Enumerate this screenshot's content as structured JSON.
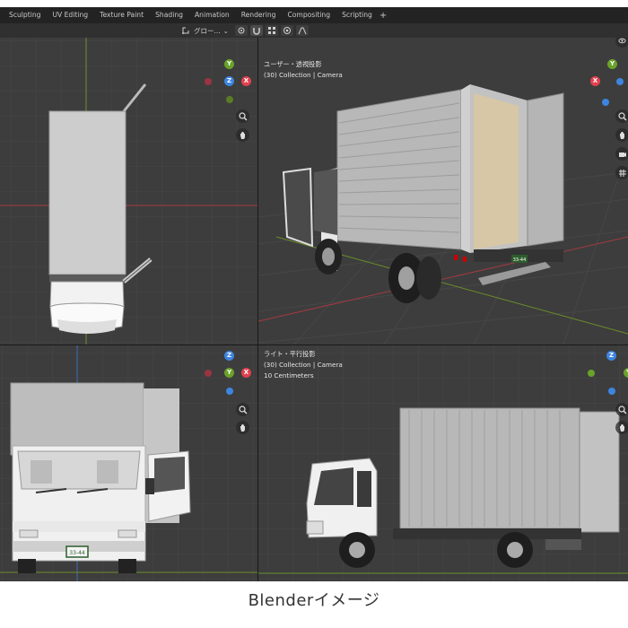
{
  "workspace_tabs": [
    "Sculpting",
    "UV Editing",
    "Texture Paint",
    "Shading",
    "Animation",
    "Rendering",
    "Compositing",
    "Scripting"
  ],
  "add_tab_label": "+",
  "header": {
    "transform_orientation": "グロー...",
    "transform_chevron": "⌄"
  },
  "viewports": {
    "top_left": {
      "view": "top",
      "object": "truck"
    },
    "top_right": {
      "view_name": "ユーザー・透視投影",
      "collection": "(30) Collection | Camera",
      "license_plate": "33-44"
    },
    "bottom_left": {
      "view": "front",
      "license_plate": "33-44"
    },
    "bottom_right": {
      "view_name": "ライト・平行投影",
      "collection": "(30) Collection | Camera",
      "scale": "10 Centimeters"
    }
  },
  "gizmo": {
    "x_label": "X",
    "y_label": "Y",
    "z_label": "Z",
    "x_color": "#e0414f",
    "y_color": "#6aa22a",
    "z_color": "#3d85e0"
  },
  "colors": {
    "viewport_bg": "#3d3d3d",
    "grid_line": "#474747",
    "axis_red": "#a33a42",
    "axis_green": "#6b8e2a",
    "axis_blue": "#3d6fb0",
    "truck_body": "#c8c8c8",
    "cab_white": "#efefef"
  },
  "caption": "Blenderイメージ"
}
